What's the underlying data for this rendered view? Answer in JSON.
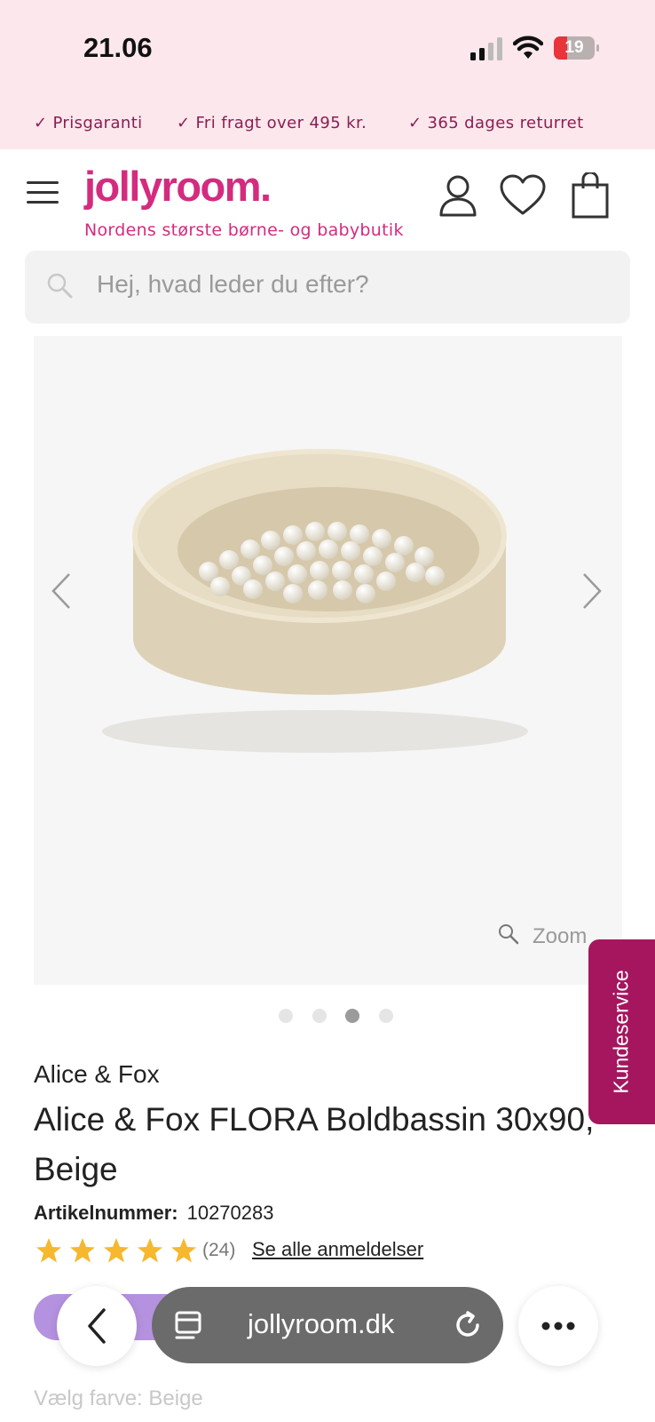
{
  "status_bar": {
    "time": "21.06",
    "battery": "19"
  },
  "promo": {
    "items": [
      "Prisgaranti",
      "Fri fragt over 495 kr.",
      "365 dages returret"
    ]
  },
  "header": {
    "logo": "jollyroom.",
    "tagline": "Nordens største børne- og babybutik"
  },
  "search": {
    "placeholder": "Hej, hvad leder du efter?"
  },
  "gallery": {
    "zoom_label": "Zoom",
    "image_count": 4,
    "active_index": 2
  },
  "kundeservice": {
    "label": "Kundeservice"
  },
  "product": {
    "brand": "Alice & Fox",
    "title": "Alice & Fox FLORA Boldbassin 30x90, Beige",
    "article_label": "Artikelnummer:",
    "article_number": "10270283",
    "rating": 5,
    "review_count": "(24)",
    "reviews_link": "Se alle anmeldelser",
    "choose_color": "Vælg farve: Beige"
  },
  "browser": {
    "url": "jollyroom.dk"
  },
  "colors": {
    "brand_pink": "#d32c7f",
    "promo_bg": "#fce7ec",
    "kundeservice_bg": "#a5165f",
    "star": "#f5b82e"
  }
}
